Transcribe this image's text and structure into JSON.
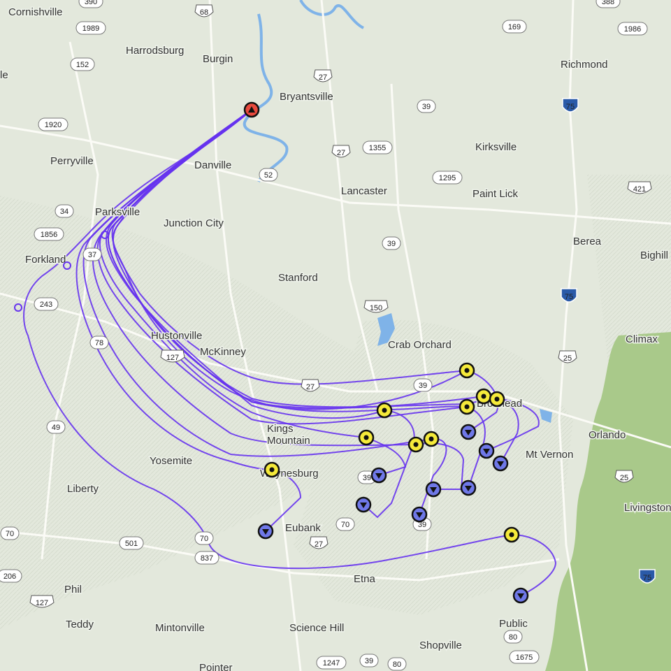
{
  "map": {
    "colors": {
      "land": "#e3e8dc",
      "water": "#7fb3e8",
      "forest": "#a7c98a",
      "road": "#f7f7f2",
      "interstate_shield": "#2a5aa8",
      "track": "#6633ee",
      "launch_marker": "#e84a3e",
      "waypoint_marker": "#f5ea3a",
      "landing_marker": "#6f78e8"
    },
    "places": [
      {
        "id": "cornishville",
        "name": "Cornishville"
      },
      {
        "id": "harrodsburg",
        "name": "Harrodsburg"
      },
      {
        "id": "burgin",
        "name": "Burgin"
      },
      {
        "id": "bryantsville",
        "name": "Bryantsville"
      },
      {
        "id": "richmond",
        "name": "Richmond"
      },
      {
        "id": "perryville",
        "name": "Perryville"
      },
      {
        "id": "danville",
        "name": "Danville"
      },
      {
        "id": "kirksville",
        "name": "Kirksville"
      },
      {
        "id": "lancaster",
        "name": "Lancaster"
      },
      {
        "id": "paint-lick",
        "name": "Paint Lick"
      },
      {
        "id": "parksville",
        "name": "Parksville"
      },
      {
        "id": "junction-city",
        "name": "Junction City"
      },
      {
        "id": "forkland",
        "name": "Forkland"
      },
      {
        "id": "berea",
        "name": "Berea"
      },
      {
        "id": "bighill",
        "name": "Bighill"
      },
      {
        "id": "stanford",
        "name": "Stanford"
      },
      {
        "id": "crab-orchard",
        "name": "Crab Orchard"
      },
      {
        "id": "climax",
        "name": "Climax"
      },
      {
        "id": "hustonville",
        "name": "Hustonville"
      },
      {
        "id": "mckinney",
        "name": "McKinney"
      },
      {
        "id": "brodhead",
        "name": "Brodhead"
      },
      {
        "id": "kings-mountain",
        "name": "Kings\nMountain"
      },
      {
        "id": "orlando",
        "name": "Orlando"
      },
      {
        "id": "mt-vernon",
        "name": "Mt Vernon"
      },
      {
        "id": "yosemite",
        "name": "Yosemite"
      },
      {
        "id": "waynesburg",
        "name": "Waynesburg"
      },
      {
        "id": "liberty",
        "name": "Liberty"
      },
      {
        "id": "livingston",
        "name": "Livingston"
      },
      {
        "id": "eubank",
        "name": "Eubank"
      },
      {
        "id": "etna",
        "name": "Etna"
      },
      {
        "id": "phil",
        "name": "Phil"
      },
      {
        "id": "public",
        "name": "Public"
      },
      {
        "id": "teddy",
        "name": "Teddy"
      },
      {
        "id": "mintonville",
        "name": "Mintonville"
      },
      {
        "id": "science-hill",
        "name": "Science Hill"
      },
      {
        "id": "shopville",
        "name": "Shopville"
      },
      {
        "id": "pointer",
        "name": "Pointer"
      },
      {
        "id": "le",
        "name": "le"
      }
    ],
    "route_shields": [
      {
        "id": "r390",
        "number": "390",
        "type": "state"
      },
      {
        "id": "r68",
        "number": "68",
        "type": "us"
      },
      {
        "id": "r1989",
        "number": "1989",
        "type": "state"
      },
      {
        "id": "r152",
        "number": "152",
        "type": "state"
      },
      {
        "id": "r1920",
        "number": "1920",
        "type": "state"
      },
      {
        "id": "r169",
        "number": "169",
        "type": "state"
      },
      {
        "id": "r1986",
        "number": "1986",
        "type": "state"
      },
      {
        "id": "r388",
        "number": "388",
        "type": "state"
      },
      {
        "id": "r27a",
        "number": "27",
        "type": "us"
      },
      {
        "id": "r39a",
        "number": "39",
        "type": "state"
      },
      {
        "id": "r75a",
        "number": "75",
        "type": "interstate"
      },
      {
        "id": "r27b",
        "number": "27",
        "type": "us"
      },
      {
        "id": "r1355",
        "number": "1355",
        "type": "state"
      },
      {
        "id": "r52",
        "number": "52",
        "type": "state"
      },
      {
        "id": "r1295",
        "number": "1295",
        "type": "state"
      },
      {
        "id": "r421",
        "number": "421",
        "type": "us"
      },
      {
        "id": "r34",
        "number": "34",
        "type": "state"
      },
      {
        "id": "r1856",
        "number": "1856",
        "type": "state"
      },
      {
        "id": "r37",
        "number": "37",
        "type": "state"
      },
      {
        "id": "r39b",
        "number": "39",
        "type": "state"
      },
      {
        "id": "r243",
        "number": "243",
        "type": "state"
      },
      {
        "id": "r150",
        "number": "150",
        "type": "us"
      },
      {
        "id": "r75b",
        "number": "75",
        "type": "interstate"
      },
      {
        "id": "r127a",
        "number": "127",
        "type": "us"
      },
      {
        "id": "r78",
        "number": "78",
        "type": "state"
      },
      {
        "id": "r25a",
        "number": "25",
        "type": "us"
      },
      {
        "id": "r27c",
        "number": "27",
        "type": "us"
      },
      {
        "id": "r39c",
        "number": "39",
        "type": "state"
      },
      {
        "id": "r49",
        "number": "49",
        "type": "state"
      },
      {
        "id": "r25b",
        "number": "25",
        "type": "us"
      },
      {
        "id": "r39d",
        "number": "39",
        "type": "state"
      },
      {
        "id": "r70a",
        "number": "70",
        "type": "state"
      },
      {
        "id": "r27d",
        "number": "27",
        "type": "us"
      },
      {
        "id": "r39e",
        "number": "39",
        "type": "state"
      },
      {
        "id": "r70b",
        "number": "70",
        "type": "state"
      },
      {
        "id": "r501",
        "number": "501",
        "type": "state"
      },
      {
        "id": "r70c",
        "number": "70",
        "type": "state"
      },
      {
        "id": "r837",
        "number": "837",
        "type": "state"
      },
      {
        "id": "r206",
        "number": "206",
        "type": "state"
      },
      {
        "id": "r75c",
        "number": "75",
        "type": "interstate"
      },
      {
        "id": "r127b",
        "number": "127",
        "type": "us"
      },
      {
        "id": "r80",
        "number": "80",
        "type": "state"
      },
      {
        "id": "r1247",
        "number": "1247",
        "type": "state"
      },
      {
        "id": "r39f",
        "number": "39",
        "type": "state"
      },
      {
        "id": "r80b",
        "number": "80",
        "type": "state"
      },
      {
        "id": "r1675",
        "number": "1675",
        "type": "state"
      }
    ],
    "markers": {
      "launch": {
        "type": "launch",
        "icon": "up-triangle-icon"
      },
      "waypoints_count_label": "",
      "waypoint_icon": "circle-dot-icon",
      "landing_icon": "down-triangle-icon"
    }
  }
}
